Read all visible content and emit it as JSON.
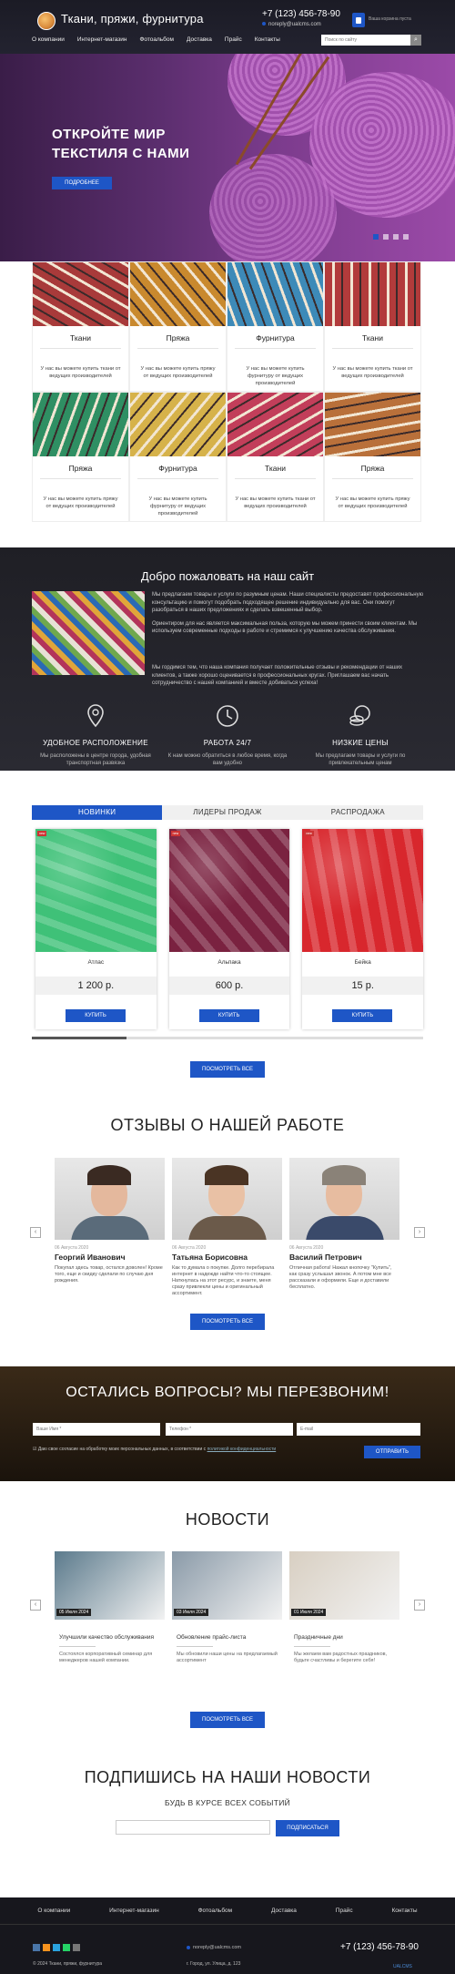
{
  "header": {
    "title": "Ткани, пряжи, фурнитура",
    "phone": "+7 (123) 456-78-90",
    "email": "noreply@ualcms.com",
    "cart": "Ваша корзина пуста",
    "nav": [
      "О компании",
      "Интернет-магазин",
      "Фотоальбом",
      "Доставка",
      "Прайс",
      "Контакты"
    ],
    "search_placeholder": "Поиск по сайту",
    "search_icon": "search-icon"
  },
  "hero": {
    "title": "ОТКРОЙТЕ МИР ТЕКСТИЛЯ С НАМИ",
    "button": "ПОДРОБНЕЕ",
    "active_slide": 1,
    "slide_count": 4
  },
  "categories": [
    {
      "name": "Ткани",
      "desc": "У нас вы можете купить ткани от ведущих производителей",
      "color": "#a83a3a"
    },
    {
      "name": "Пряжа",
      "desc": "У нас вы можете купить пряжу от ведущих производителей",
      "color": "#c9892e"
    },
    {
      "name": "Фурнитура",
      "desc": "У нас вы можете купить фурнитуру от ведущих производителей",
      "color": "#3d8ab8"
    },
    {
      "name": "Ткани",
      "desc": "У нас вы можете купить ткани от ведущих производителей",
      "color": "#b23b3b"
    },
    {
      "name": "Пряжа",
      "desc": "У нас вы можете купить пряжу от ведущих производителей",
      "color": "#2f8f63"
    },
    {
      "name": "Фурнитура",
      "desc": "У нас вы можете купить фурнитуру от ведущих производителей",
      "color": "#d6b24a"
    },
    {
      "name": "Ткани",
      "desc": "У нас вы можете купить ткани от ведущих производителей",
      "color": "#c23e5a"
    },
    {
      "name": "Пряжа",
      "desc": "У нас вы можете купить пряжу от ведущих производителей",
      "color": "#b9703a"
    }
  ],
  "welcome": {
    "title": "Добро пожаловать на наш сайт",
    "p1": "Мы предлагаем товары и услуги по разумным ценам. Наши специалисты предоставят профессиональную консультацию и помогут подобрать подходящее решение индивидуально для вас. Они помогут разобраться в наших предложениях и сделать взвешенный выбор.",
    "p2": "Ориентиром для нас является максимальная польза, которую мы можем принести своим клиентам. Мы используем современные подходы в работе и стремимся к улучшению качества обслуживания.",
    "p3": "Мы гордимся тем, что наша компания получает положительные отзывы и рекомендации от наших клиентов, а также хорошо оценивается в профессиональных кругах. Приглашаем вас начать сотрудничество с нашей компанией и вместе добиваться успеха!",
    "features": [
      {
        "title": "УДОБНОЕ РАСПОЛОЖЕНИЕ",
        "desc": "Мы расположены в центре города, удобная транспортная развязка",
        "icon": "location-pin-icon"
      },
      {
        "title": "РАБОТА 24/7",
        "desc": "К нам можно обратиться в любое время, когда вам удобно",
        "icon": "clock-24-icon"
      },
      {
        "title": "НИЗКИЕ ЦЕНЫ",
        "desc": "Мы предлагаем товары и услуги по привлекательным ценам",
        "icon": "coins-icon"
      }
    ]
  },
  "products": {
    "tabs": [
      "НОВИНКИ",
      "ЛИДЕРЫ ПРОДАЖ",
      "РАСПРОДАЖА"
    ],
    "badge": "new",
    "items": [
      {
        "name": "Атлас",
        "price": "1 200 р.",
        "buy": "КУПИТЬ",
        "color": "#3fc178"
      },
      {
        "name": "Альпака",
        "price": "600 р.",
        "buy": "КУПИТЬ",
        "color": "#7a2240"
      },
      {
        "name": "Бейка",
        "price": "15 р.",
        "buy": "КУПИТЬ",
        "color": "#d8272d"
      }
    ],
    "more": "ПОСМОТРЕТЬ ВСЕ"
  },
  "reviews": {
    "title": "ОТЗЫВЫ О НАШЕЙ РАБОТЕ",
    "items": [
      {
        "date": "06 Августа 2020",
        "name": "Георгий Иванович",
        "text": "Покупал здесь товар, остался доволен! Кроме того, еще и скидку сделали по случаю дня рождения.",
        "skin": "#e4b89d",
        "hair": "#3a2a22",
        "shirt": "#5a6b7a"
      },
      {
        "date": "06 Августа 2020",
        "name": "Татьяна Борисовна",
        "text": "Как то думала о покупке. Долго перебирала интернет в надежде найти что-то стоящее. Наткнулась на этот ресурс, и знаете, меня сразу привлекли цены и оригинальный ассортимент.",
        "skin": "#e9c1a5",
        "hair": "#4a3424",
        "shirt": "#6b5a4a"
      },
      {
        "date": "06 Августа 2020",
        "name": "Василий Петрович",
        "text": "Отличная работа! Нажал кнопочку \"Купить\", как сразу услышал звонок. А потом мне все рассказали и оформили. Еще и доставили бесплатно.",
        "skin": "#e7bca0",
        "hair": "#8a8278",
        "shirt": "#3a4a6a"
      }
    ],
    "more": "ПОСМОТРЕТЬ ВСЕ"
  },
  "callback": {
    "title": "ОСТАЛИСЬ ВОПРОСЫ? МЫ ПЕРЕЗВОНИМ!",
    "name_ph": "Ваше Имя *",
    "phone_ph": "Телефон *",
    "email_ph": "E-mail",
    "consent": "Даю свое согласие на обработку моих персональных данных, в соответствии с",
    "consent_link": "политикой конфиденциальности",
    "submit": "ОТПРАВИТЬ"
  },
  "news": {
    "title": "НОВОСТИ",
    "items": [
      {
        "date": "05 Июля 2024",
        "title": "Улучшили качество обслуживания",
        "desc": "Состоялся корпоративный семинар для менеджеров нашей компании.",
        "color": "#5b7a8c"
      },
      {
        "date": "03 Июля 2024",
        "title": "Обновление прайс-листа",
        "desc": "Мы обновили наши цены на предлагаемый ассортимент",
        "color": "#8a9aa8"
      },
      {
        "date": "01 Июля 2024",
        "title": "Праздничные дни",
        "desc": "Мы желаем вам радостных праздников, будьте счастливы и берегите себя!",
        "color": "#d8cfc2"
      }
    ],
    "more": "ПОСМОТРЕТЬ ВСЕ"
  },
  "subscribe": {
    "title": "ПОДПИШИСЬ НА НАШИ НОВОСТИ",
    "subtitle": "БУДЬ В КУРСЕ ВСЕХ СОБЫТИЙ",
    "button": "ПОДПИСАТЬСЯ"
  },
  "footer": {
    "nav": [
      "О компании",
      "Интернет-магазин",
      "Фотоальбом",
      "Доставка",
      "Прайс",
      "Контакты"
    ],
    "copyright": "© 2024 Ткани, пряжи, фурнитура",
    "email": "noreply@ualcms.com",
    "address": "г. Город, ул. Улица, д. 123",
    "phone": "+7 (123) 456-78-90",
    "brand": "UALCMS"
  },
  "colors": {
    "accent": "#1e56c6",
    "dark": "#1f1f25"
  }
}
